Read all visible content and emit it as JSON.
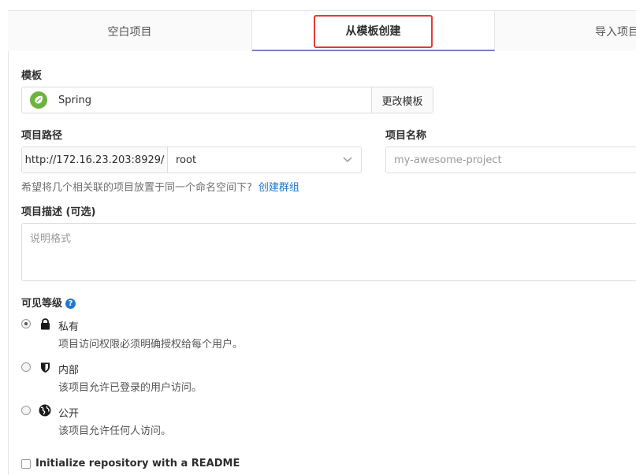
{
  "tabs": [
    {
      "label": "空白项目"
    },
    {
      "label": "从模板创建"
    },
    {
      "label": "导入项目"
    }
  ],
  "template": {
    "label": "模板",
    "name": "Spring",
    "change_button": "更改模板"
  },
  "path": {
    "label": "项目路径",
    "prefix": "http://172.16.23.203:8929/",
    "namespace": "root"
  },
  "project_name": {
    "label": "项目名称",
    "placeholder": "my-awesome-project"
  },
  "group_hint": {
    "text": "希望将几个相关联的项目放置于同一个命名空间下?",
    "link": "创建群组"
  },
  "description": {
    "label": "项目描述 (可选)",
    "placeholder": "说明格式"
  },
  "visibility": {
    "label": "可见等级",
    "selected": "private",
    "options": [
      {
        "title": "私有",
        "desc": "项目访问权限必须明确授权给每个用户。"
      },
      {
        "title": "内部",
        "desc": "该项目允许已登录的用户访问。"
      },
      {
        "title": "公开",
        "desc": "该项目允许任何人访问。"
      }
    ]
  },
  "readme": {
    "label": "Initialize repository with a README",
    "checked": false
  },
  "colors": {
    "accent": "#1f78d1",
    "active_tab_underline": "#7f7fbf",
    "highlight": "#e53935",
    "spring_green": "#6db33f"
  }
}
